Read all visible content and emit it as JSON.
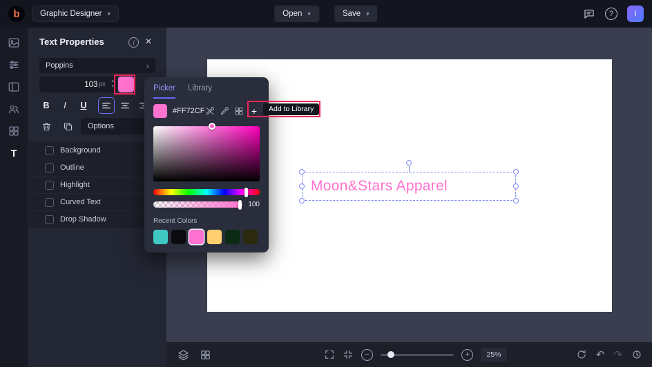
{
  "colors": {
    "accent": "#6468F2",
    "pink": "#FF72CF",
    "annotation_red": "#EF2456",
    "canvas_bg": "#3A3E4F"
  },
  "topbar": {
    "logo_letter": "b",
    "app_menu_label": "Graphic Designer",
    "open_label": "Open",
    "save_label": "Save",
    "avatar_letter": "I"
  },
  "rail": {
    "text_tool_label": "T"
  },
  "panel": {
    "title": "Text Properties",
    "font_name": "Poppins",
    "font_size": "103",
    "font_size_unit": "px",
    "bold_label": "B",
    "italic_label": "I",
    "underline_label": "U",
    "options_label": "Options",
    "swatch_color": "#FF72CF",
    "checkboxes": [
      {
        "label": "Background",
        "checked": false
      },
      {
        "label": "Outline",
        "checked": false
      },
      {
        "label": "Highlight",
        "checked": false
      },
      {
        "label": "Curved Text",
        "checked": false
      },
      {
        "label": "Drop Shadow",
        "checked": false
      }
    ]
  },
  "picker": {
    "tabs": {
      "picker": "Picker",
      "library": "Library"
    },
    "active_tab": "Picker",
    "hex_value": "#FF72CF",
    "current_color": "#FF72CF",
    "add_tooltip": "Add to Library",
    "opacity_value": "100",
    "recent_title": "Recent Colors",
    "recent_colors": [
      "#3FC8C3",
      "#0B0B0F",
      "#FF72CF",
      "#FFCF6F",
      "#0B2B15",
      "#2B2A0E"
    ],
    "selected_recent_index": 2
  },
  "canvas": {
    "text": "Moon&Stars Apparel",
    "text_color": "#FF72CF"
  },
  "bottombar": {
    "zoom_value": "25%"
  },
  "icons": {
    "chevron_down": "▾",
    "chevron_right": "›",
    "stepper_up": "▴",
    "stepper_down": "▾",
    "close": "✕",
    "info": "i",
    "help": "?",
    "plus": "+",
    "minus": "−",
    "undo": "↶",
    "redo": "↷"
  }
}
